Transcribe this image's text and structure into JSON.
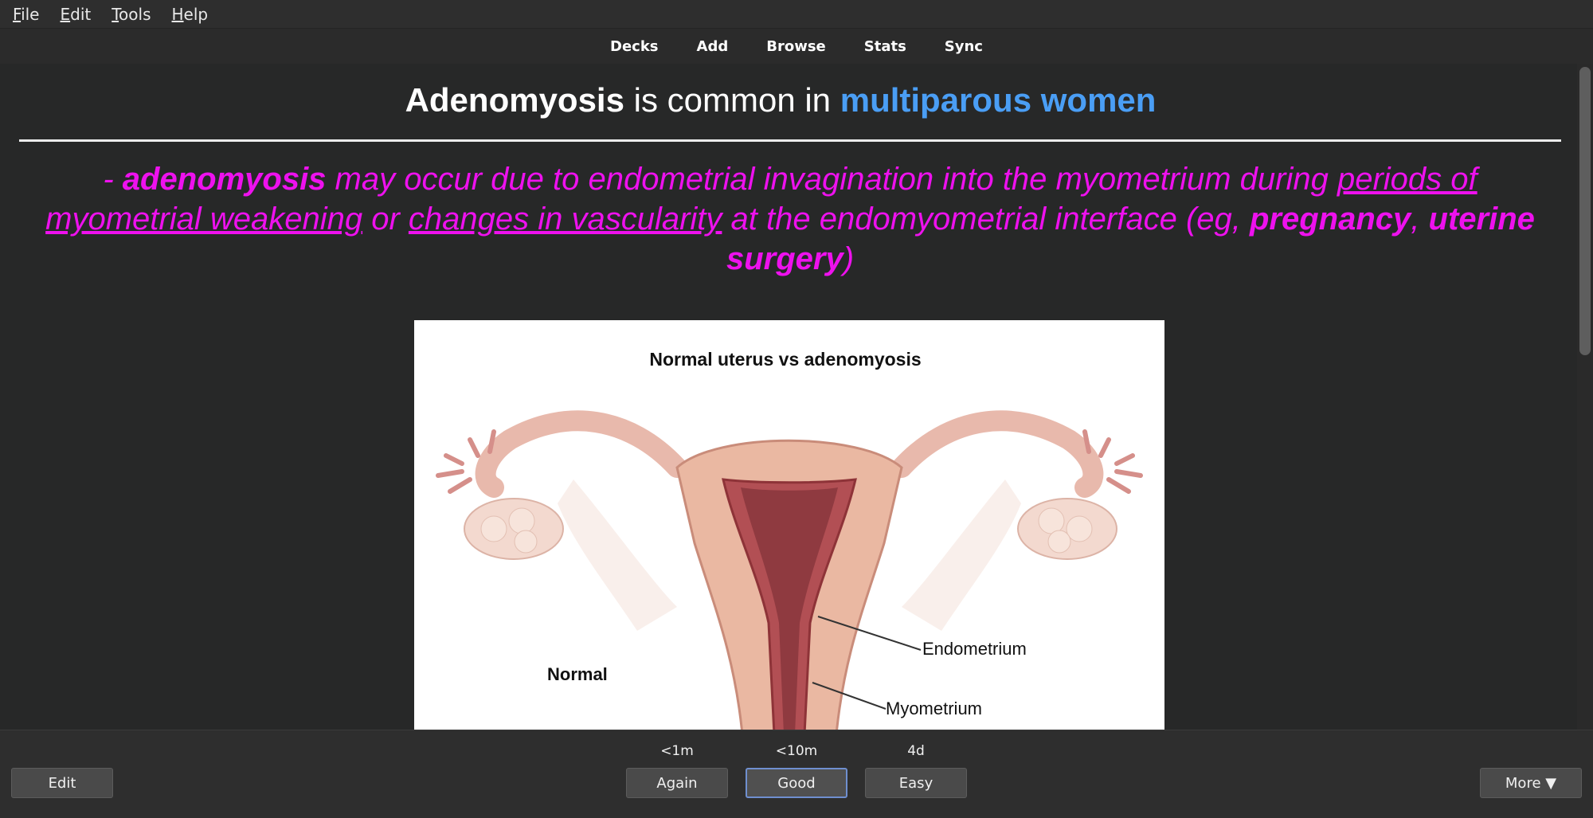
{
  "menubar": {
    "items": [
      {
        "accel": "F",
        "rest": "ile"
      },
      {
        "accel": "E",
        "rest": "dit"
      },
      {
        "accel": "T",
        "rest": "ools"
      },
      {
        "accel": "H",
        "rest": "elp"
      }
    ]
  },
  "toolbar": {
    "links": [
      "Decks",
      "Add",
      "Browse",
      "Stats",
      "Sync"
    ]
  },
  "card": {
    "front": {
      "bold": "Adenomyosis",
      "middle": " is common in ",
      "highlight": "multiparous women"
    },
    "extra": {
      "lead": "- ",
      "term": "adenomyosis",
      "t1": " may occur due to endometrial invagination into the myometrium during ",
      "u1": "periods of myometrial weakening",
      "t2": " or ",
      "u2": "changes in vascularity",
      "t3": " at the endomyometrial interface (eg, ",
      "b1": "pregnancy",
      "t4": ", ",
      "b2": "uterine surgery",
      "t5": ")"
    },
    "image": {
      "title": "Normal uterus vs adenomyosis",
      "label_normal": "Normal",
      "label_endometrium": "Endometrium",
      "label_myometrium": "Myometrium"
    }
  },
  "bottombar": {
    "edit_label": "Edit",
    "again": {
      "label": "Again",
      "interval": "<1m"
    },
    "good": {
      "label": "Good",
      "interval": "<10m"
    },
    "easy": {
      "label": "Easy",
      "interval": "4d"
    },
    "more_label": "More ▼"
  },
  "colors": {
    "highlight_blue": "#4a9ef5",
    "extra_magenta": "#ee11ee",
    "background": "#272828"
  }
}
